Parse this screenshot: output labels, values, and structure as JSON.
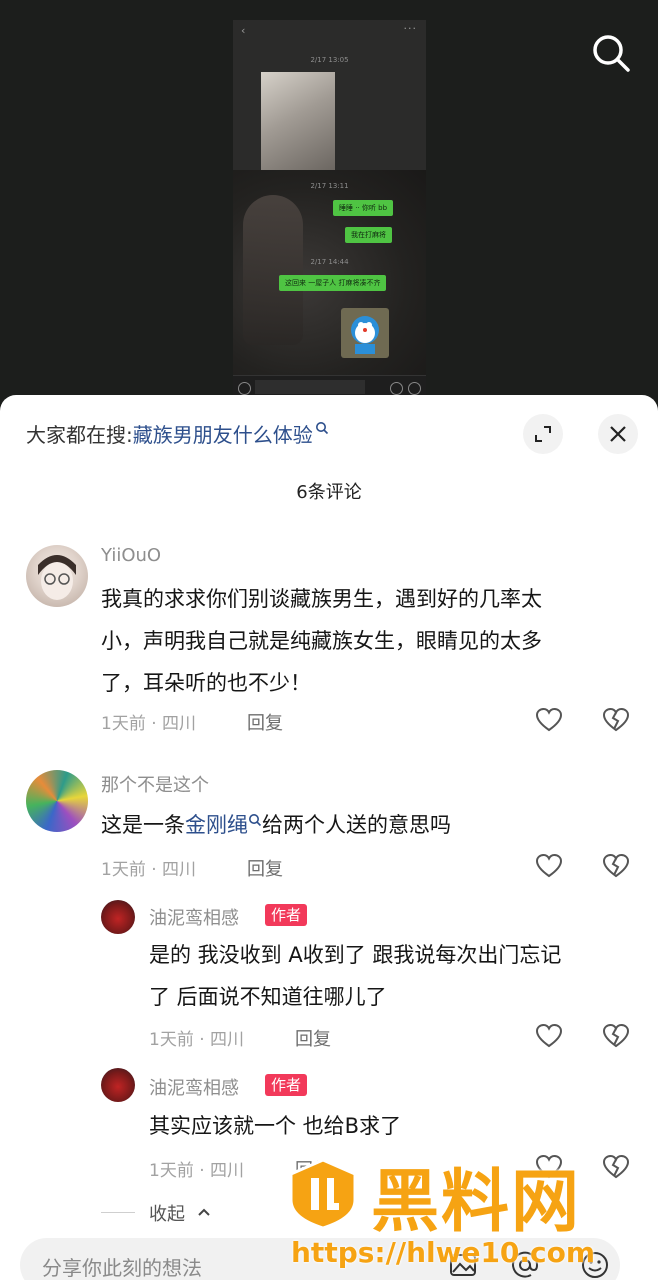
{
  "header": {
    "search_icon": "search-icon"
  },
  "screenshot": {
    "times": [
      "2/17 13:05",
      "2/17 13:11",
      "2/17 14:44"
    ],
    "bubbles": [
      "睡睡 ·· 你听 bb",
      "我在打麻将",
      "这回来 一屋子人 打麻将凑不齐"
    ]
  },
  "sheet": {
    "search_prefix": "大家都在搜:",
    "search_link": "藏族男朋友什么体验",
    "count": "6条评论",
    "buttons": {
      "expand_icon": "expand-icon",
      "close_icon": "close-icon"
    }
  },
  "comments": [
    {
      "name": "YiiOuO",
      "lines": [
        "我真的求求你们别谈藏族男生，遇到好的几率太",
        "小，声明我自己就是纯藏族女生，眼睛见的太多",
        "了，耳朵听的也不少！"
      ],
      "meta": "1天前 · 四川",
      "reply": "回复"
    },
    {
      "name": "那个不是这个",
      "text_before": "这是一条",
      "text_link": "金刚绳",
      "text_after": "给两个人送的意思吗",
      "meta": "1天前 · 四川",
      "reply": "回复",
      "replies": [
        {
          "name": "油泥鸾相感",
          "badge": "作者",
          "lines": [
            "是的 我没收到 A收到了 跟我说每次出门忘记",
            "了 后面说不知道往哪儿了"
          ],
          "meta": "1天前 · 四川",
          "reply": "回复"
        },
        {
          "name": "油泥鸾相感",
          "badge": "作者",
          "lines": [
            "其实应该就一个 也给B求了"
          ],
          "meta": "1天前 · 四川",
          "reply": "回复"
        }
      ]
    }
  ],
  "collapse_label": "收起",
  "input": {
    "placeholder": "分享你此刻的想法"
  },
  "watermark": {
    "title": "黑料网",
    "url": "https://hlwe10.com"
  }
}
